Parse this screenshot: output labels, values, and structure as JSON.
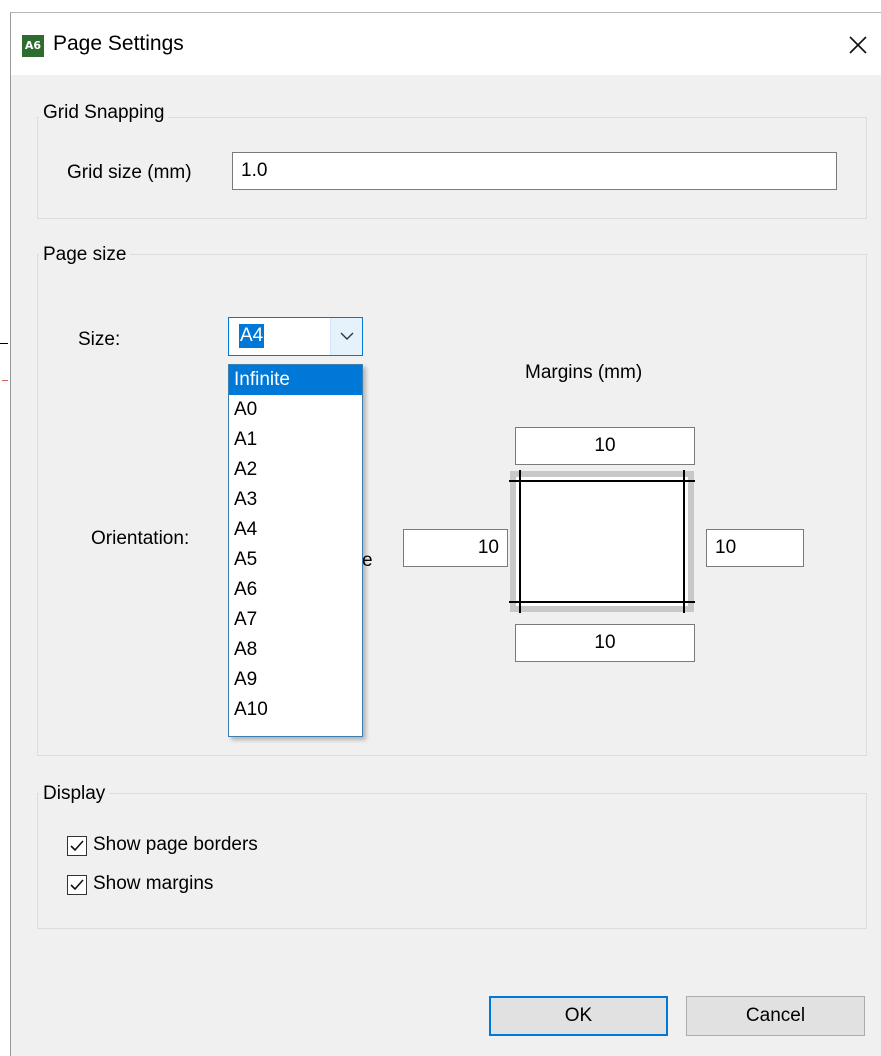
{
  "window": {
    "title": "Page Settings",
    "app_icon_text": "A6"
  },
  "grid_snapping": {
    "group_label": "Grid Snapping",
    "grid_size_label": "Grid size (mm)",
    "grid_size_value": "1.0"
  },
  "page_size": {
    "group_label": "Page size",
    "size_label": "Size:",
    "size_value": "A4",
    "size_options": [
      "Infinite",
      "A0",
      "A1",
      "A2",
      "A3",
      "A4",
      "A5",
      "A6",
      "A7",
      "A8",
      "A9",
      "A10"
    ],
    "highlighted_option": "Infinite",
    "orientation_label": "Orientation:",
    "orientation_partial_text": "e",
    "margins_label": "Margins (mm)",
    "margin_top": "10",
    "margin_left": "10",
    "margin_right": "10",
    "margin_bottom": "10"
  },
  "display": {
    "group_label": "Display",
    "show_page_borders_label": "Show page borders",
    "show_page_borders_checked": true,
    "show_margins_label": "Show margins",
    "show_margins_checked": true
  },
  "buttons": {
    "ok_label": "OK",
    "cancel_label": "Cancel"
  },
  "colors": {
    "accent": "#0078d7",
    "dialog_background": "#f0f0f0",
    "app_icon": "#2e6b2e"
  },
  "icons": {
    "close": "close-icon",
    "dropdown": "chevron-down-icon",
    "check": "checkmark-icon"
  }
}
